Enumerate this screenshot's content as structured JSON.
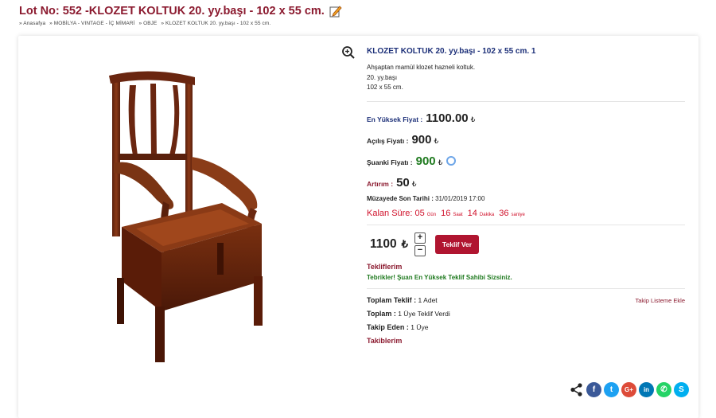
{
  "page": {
    "title": "Lot No: 552 -KLOZET KOLTUK 20. yy.başı - 102 x 55 cm.",
    "breadcrumb": [
      "» Anasafya",
      "» MOBİLYA - VINTAGE - İÇ MİMARİ",
      "» OBJE",
      "» KLOZET KOLTUK 20. yy.başı - 102 x 55 cm."
    ]
  },
  "product": {
    "title": "KLOZET KOLTUK 20. yy.başı - 102 x 55 cm. 1",
    "desc_lines": [
      "Ahşaptan mamül klozet hazneli koltuk.",
      "20. yy.başı",
      "102 x 55 cm."
    ]
  },
  "prices": {
    "highest_label": "En Yüksek Fiyat :",
    "highest_value": "1100.00",
    "opening_label": "Açılış Fiyatı :",
    "opening_value": "900",
    "current_label": "Şuanki Fiyatı :",
    "current_value": "900",
    "increment_label": "Artırım :",
    "increment_value": "50",
    "currency": "₺"
  },
  "auction": {
    "deadline_label": "Müzayede Son Tarihi :",
    "deadline_value": "31/01/2019 17:00",
    "remaining_label": "Kalan Süre:",
    "days": "05",
    "days_unit": "Gün",
    "hours": "16",
    "hours_unit": "Saat",
    "minutes": "14",
    "minutes_unit": "Dakika",
    "seconds": "36",
    "seconds_unit": "saniye"
  },
  "bid": {
    "amount": "1100",
    "currency": "₺",
    "plus": "+",
    "minus": "−",
    "button": "Teklif Ver"
  },
  "offers": {
    "title": "Tekliflerim",
    "message": "Tebrikler! Şuan En Yüksek Teklif Sahibi Sizsiniz."
  },
  "stats": {
    "total_bids_label": "Toplam Teklif :",
    "total_bids_value": "1 Adet",
    "total_label": "Toplam :",
    "total_value": "1 Üye Teklif Verdi",
    "followers_label": "Takip Eden :",
    "followers_value": "1 Üye",
    "followers_link": "Takiblerim",
    "watchlist_link": "Takip Listeme Ekle"
  },
  "colors": {
    "maroon": "#8b1a2f",
    "navy": "#1c2f78",
    "green": "#1f7a1f",
    "red": "#d0102a",
    "facebook": "#3b5998",
    "twitter": "#1da1f2",
    "google": "#dd4b39",
    "linkedin": "#0077b5",
    "whatsapp": "#25d366",
    "skype": "#00aff0"
  },
  "share": [
    "share-icon",
    "facebook-icon",
    "twitter-icon",
    "google-plus-icon",
    "linkedin-icon",
    "whatsapp-icon",
    "skype-icon"
  ]
}
